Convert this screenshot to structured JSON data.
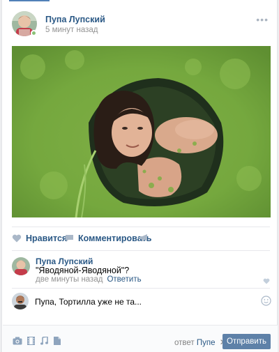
{
  "post": {
    "author": "Пупа Лупский",
    "time": "5 минут назад",
    "more": "•••"
  },
  "actions": {
    "like_label": "Нравится",
    "comment_label": "Комментировать"
  },
  "comment": {
    "author": "Пупа Лупский",
    "text": "\"Яводяной-Яводяной\"?",
    "time": "две минуты назад",
    "reply_label": "Ответить"
  },
  "reply_box": {
    "value": "Пупа, Тортилла уже не та..."
  },
  "bottom_bar": {
    "reply_prefix": "ответ",
    "reply_to_name": "Пупе",
    "cancel": "✕",
    "send_label": "Отправить"
  },
  "icons": {
    "like": "heart-icon",
    "comment": "speech-bubble-icon",
    "share": "megaphone-icon",
    "photo": "camera-icon",
    "video": "film-icon",
    "audio": "music-note-icon",
    "document": "document-icon",
    "emoji": "smiley-icon"
  },
  "colors": {
    "link": "#2a5885",
    "accent": "#5181b8",
    "button": "#5e81a8",
    "muted": "#939393"
  }
}
